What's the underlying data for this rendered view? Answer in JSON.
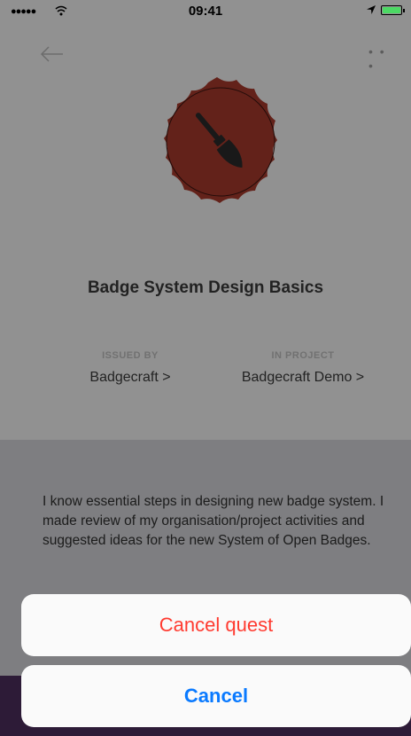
{
  "status_bar": {
    "signal": "●●●●●",
    "time": "09:41"
  },
  "nav": {
    "back_icon": "arrow-left-icon",
    "more_icon": "more-dots-icon",
    "more_glyph": "• • •"
  },
  "badge": {
    "icon": "paintbrush-icon",
    "color": "#a6392c"
  },
  "title": "Badge System Design Basics",
  "issued_by": {
    "label": "ISSUED BY",
    "value": "Badgecraft >"
  },
  "in_project": {
    "label": "IN PROJECT",
    "value": "Badgecraft Demo >"
  },
  "description": "I know essential steps in designing new badge system. I made review of my organisation/project activities and suggested ideas for the new System of Open Badges.",
  "action_sheet": {
    "cancel_quest_label": "Cancel quest",
    "cancel_label": "Cancel",
    "destructive_color": "#ff3b30",
    "cancel_color": "#0a7aff"
  }
}
